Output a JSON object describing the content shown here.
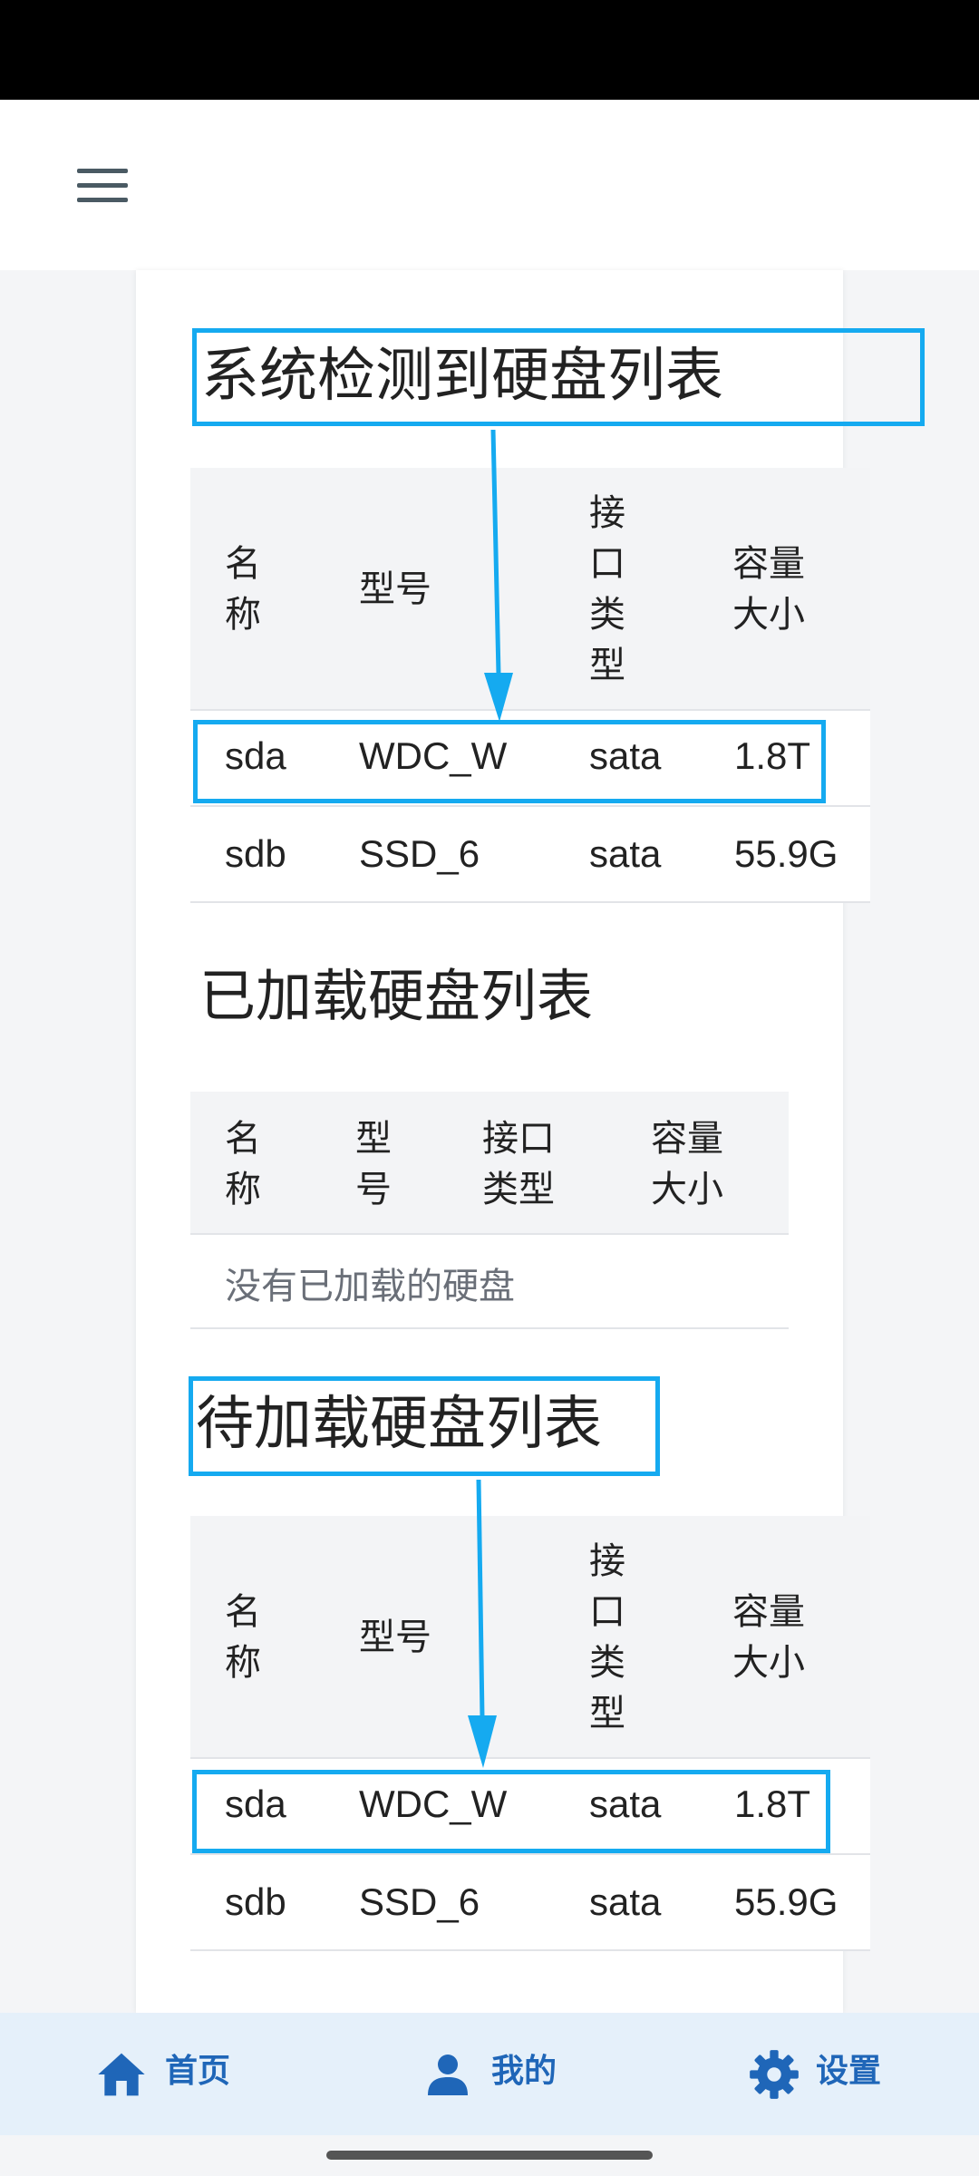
{
  "sections": {
    "detected": {
      "title": "系统检测到硬盘列表",
      "headers": [
        "名称",
        "型号",
        "接口类型",
        "容量大小"
      ],
      "rows": [
        [
          "sda",
          "WDC_W",
          "sata",
          "1.8T"
        ],
        [
          "sdb",
          "SSD_6",
          "sata",
          "55.9G"
        ]
      ]
    },
    "mounted": {
      "title": "已加载硬盘列表",
      "headers": [
        "名称",
        "型号",
        "接口类型",
        "容量大小"
      ],
      "empty_text": "没有已加载的硬盘"
    },
    "pending": {
      "title": "待加载硬盘列表",
      "headers": [
        "名称",
        "型号",
        "接口类型",
        "容量大小"
      ],
      "rows": [
        [
          "sda",
          "WDC_W",
          "sata",
          "1.8T"
        ],
        [
          "sdb",
          "SSD_6",
          "sata",
          "55.9G"
        ]
      ]
    }
  },
  "bottom_nav": [
    {
      "label": "首页",
      "icon": "home-icon"
    },
    {
      "label": "我的",
      "icon": "person-icon"
    },
    {
      "label": "设置",
      "icon": "gear-icon"
    }
  ],
  "colors": {
    "highlight": "#15aaf0",
    "nav_background": "#e5f0fa",
    "nav_accent": "#1f66b8"
  }
}
